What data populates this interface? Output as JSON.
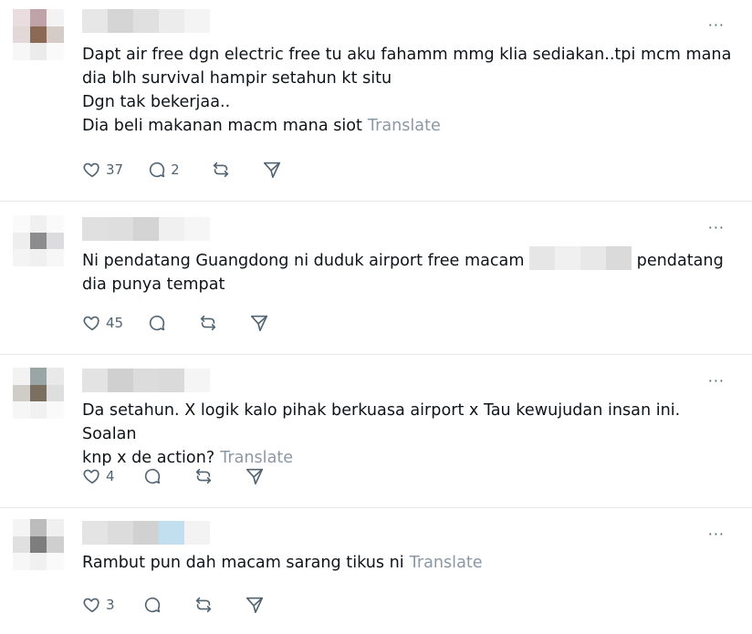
{
  "more_label": "···",
  "translate_label": "Translate",
  "posts": [
    {
      "text_lines": [
        "Dapt air free dgn electric free tu aku fahamm mmg klia sediakan..tpi mcm mana",
        "dia blh survival hampir setahun kt situ",
        "Dgn tak bekerjaa..",
        "Dia beli makanan macm mana siot"
      ],
      "likes": "37",
      "replies": "2",
      "avatar_colors": [
        "#e9dde0",
        "#bfa3a9",
        "#f3f3f3",
        "#e2d8d8",
        "#8a6a55",
        "#d5ccc7",
        "#f7f7f7",
        "#ebebeb",
        "#fafafa"
      ],
      "name_colors": [
        "#e7e7e7",
        "#d5d5d5",
        "#e0e0e0",
        "#ececec",
        "#f4f4f4"
      ]
    },
    {
      "text_before_blur": "Ni pendatang Guangdong ni duduk airport free macam ",
      "text_after_blur": " pendatang",
      "text_line2": "dia punya tempat",
      "likes": "45",
      "avatar_colors": [
        "#fafafa",
        "#f0f0f0",
        "#fafafa",
        "#eeeeef",
        "#8c8c8f",
        "#dcdcdf",
        "#f4f4f4",
        "#f0f0f0",
        "#f7f7f7"
      ],
      "name_colors": [
        "#e0e0e0",
        "#dedede",
        "#d4d4d4",
        "#f0f0f0",
        "#f6f6f6"
      ],
      "blur_colors": [
        "#e6e6e6",
        "#f0f0f0",
        "#e8e8e8",
        "#dadada"
      ]
    },
    {
      "text_lines": [
        "Da setahun. X logik kalo pihak berkuasa airport x Tau kewujudan insan ini. Soalan",
        "knp x de action?"
      ],
      "likes": "4",
      "avatar_colors": [
        "#f2f2f2",
        "#9aa5a5",
        "#e9e9e9",
        "#d0ccc7",
        "#7b6f5f",
        "#dedede",
        "#f6f6f6",
        "#f1f1f1",
        "#fafafa"
      ],
      "name_colors": [
        "#e3e3e3",
        "#d0d0d0",
        "#dcdcdc",
        "#dadada",
        "#f5f5f5"
      ]
    },
    {
      "text_lines": [
        "Rambut pun dah macam sarang tikus ni"
      ],
      "likes": "3",
      "avatar_colors": [
        "#f4f4f4",
        "#bcbcbc",
        "#f0f0f0",
        "#e0e0e0",
        "#7d7d7d",
        "#cfcfcf",
        "#f7f7f7",
        "#f0f0f0",
        "#fafafa"
      ],
      "name_colors": [
        "#e4e4e4",
        "#dcdcdc",
        "#d1d1d1",
        "#c2dff0",
        "#f3f3f3"
      ]
    }
  ]
}
